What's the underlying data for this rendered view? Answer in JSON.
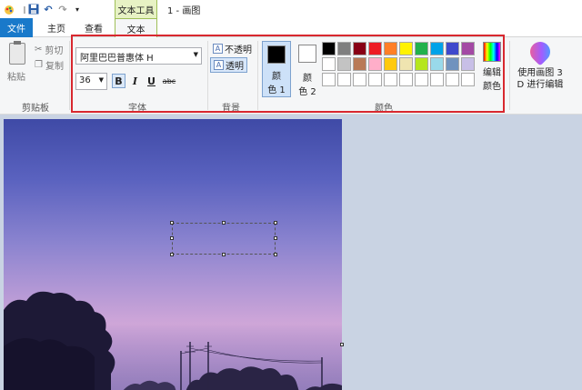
{
  "titlebar": {
    "context_tab": "文本工具",
    "title": "1 - 画图"
  },
  "tabs": {
    "file": "文件",
    "home": "主页",
    "view": "查看",
    "text": "文本"
  },
  "clipboard": {
    "paste": "粘贴",
    "cut": "剪切",
    "copy": "复制",
    "group_label": "剪贴板"
  },
  "font": {
    "family": "阿里巴巴普惠体 H",
    "size": "36",
    "bold": "B",
    "italic": "I",
    "underline": "U",
    "strikethrough": "abc",
    "group_label": "字体"
  },
  "background": {
    "opaque": "不透明",
    "transparent": "透明",
    "group_label": "背景"
  },
  "colors": {
    "color1_line1": "颜",
    "color1_line2": "色 1",
    "color2_line1": "颜",
    "color2_line2": "色 2",
    "color1_value": "#000000",
    "color2_value": "#ffffff",
    "edit_line1": "编辑",
    "edit_line2": "颜色",
    "group_label": "颜色",
    "palette_row1": [
      "#000000",
      "#7f7f7f",
      "#880015",
      "#ed1c24",
      "#ff7f27",
      "#fff200",
      "#22b14c",
      "#00a2e8",
      "#3f48cc",
      "#a349a4"
    ],
    "palette_row2": [
      "#ffffff",
      "#c3c3c3",
      "#b97a57",
      "#ffaec9",
      "#ffc90e",
      "#efe4b0",
      "#b5e61d",
      "#99d9ea",
      "#7092be",
      "#c8bfe7"
    ],
    "palette_row3": [
      "#ffffff",
      "#ffffff",
      "#ffffff",
      "#ffffff",
      "#ffffff",
      "#ffffff",
      "#ffffff",
      "#ffffff",
      "#ffffff",
      "#ffffff"
    ]
  },
  "paint3d": {
    "line1": "使用画图 3",
    "line2": "D 进行编辑"
  },
  "accent": {
    "file_tab": "#1979ca",
    "context_tab": "#e7f2c4",
    "highlight_box": "#d8282f"
  }
}
